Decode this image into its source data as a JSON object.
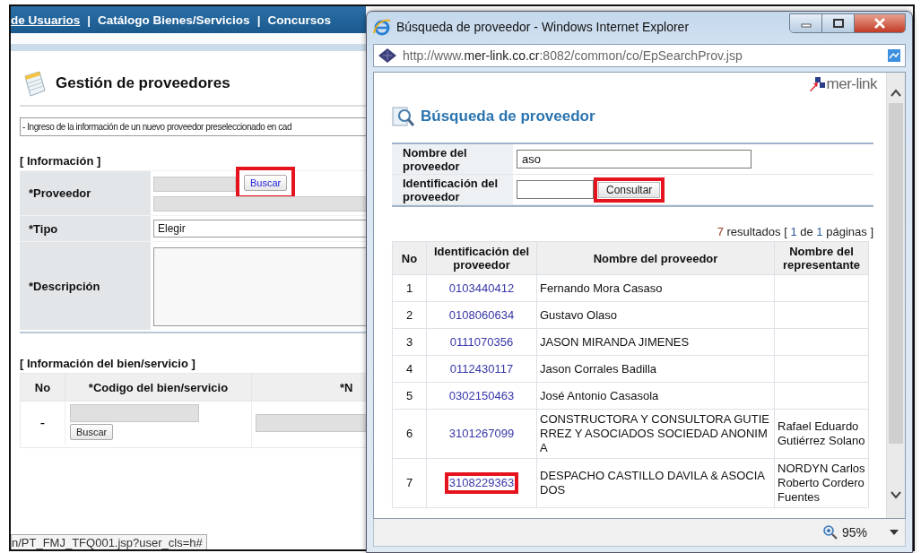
{
  "page": {
    "nav": [
      {
        "label": "de Usuarios",
        "underlined": true
      },
      {
        "label": "Catálogo Bienes/Servicios",
        "underlined": false
      },
      {
        "label": "Concursos",
        "underlined": false
      }
    ],
    "nav_separator": "|",
    "title": "Gestión de proveedores",
    "notice": "- Ingreso de la información de un nuevo proveedor preseleccionado en cad",
    "info_section": "[ Información ]",
    "fields": [
      {
        "kind": "lookup",
        "mark": "*",
        "label": "Proveedor",
        "button": "Buscar",
        "highlighted": true
      },
      {
        "kind": "select",
        "mark": "*",
        "label": "Tipo",
        "value": "Elegir"
      },
      {
        "kind": "textarea",
        "mark": "*",
        "label": "Descripción"
      }
    ],
    "items_section": "[ Información del bien/servicio ]",
    "items_table": {
      "columns": [
        {
          "label": "No"
        },
        {
          "mark": "*",
          "label": "Codigo del bien/servicio"
        },
        {
          "mark": "*",
          "label": "N"
        }
      ],
      "rows": [
        {
          "no": "-",
          "button": "Buscar"
        }
      ]
    },
    "status_url": "n/PT_FMJ_TFQ001.jsp?user_cls=h#"
  },
  "popup": {
    "title": "Búsqueda de proveedor - Windows Internet Explorer",
    "url": "http://www.**mer-link.co.cr**:8082/common/co/EpSearchProv.jsp",
    "logo": "mer-link",
    "heading": "Búsqueda de proveedor",
    "search": {
      "fields": [
        {
          "label": "Nombre del proveedor",
          "value": "aso"
        },
        {
          "label": "Identificación del proveedor"
        }
      ],
      "button": "Consultar",
      "highlighted": true
    },
    "results": {
      "count": "7",
      "label": "resultados",
      "open": "[",
      "page": "1",
      "of": "de",
      "total": "1",
      "pages_label": "páginas",
      "close": "]"
    },
    "table": {
      "columns": [
        "No",
        "Identificación del proveedor",
        "Nombre del proveedor",
        "Nombre del representante"
      ],
      "rows": [
        {
          "no": "1",
          "id": "0103440412",
          "name": "Fernando Mora Casaso",
          "highlighted": false
        },
        {
          "no": "2",
          "id": "0108060634",
          "name": "Gustavo Olaso",
          "highlighted": false
        },
        {
          "no": "3",
          "id": "0111070356",
          "name": "JASON MIRANDA JIMENES",
          "highlighted": false
        },
        {
          "no": "4",
          "id": "0112430117",
          "name": "Jason Corrales Badilla",
          "highlighted": false
        },
        {
          "no": "5",
          "id": "0302150463",
          "name": "José Antonio Casasola",
          "highlighted": false
        },
        {
          "no": "6",
          "id": "3101267099",
          "name": "CONSTRUCTORA Y CONSULTORA GUTIERREZ Y ASOCIADOS SOCIEDAD ANONIMA",
          "representative": "Rafael Eduardo Gutiérrez Solano",
          "highlighted": false
        },
        {
          "no": "7",
          "id": "3108229363",
          "name": "DESPACHO CASTILLO DAVILA & ASOCIADOS",
          "representative": "NORDYN Carlos Roberto Cordero Fuentes",
          "highlighted": true
        }
      ]
    },
    "zoom": "95%"
  }
}
